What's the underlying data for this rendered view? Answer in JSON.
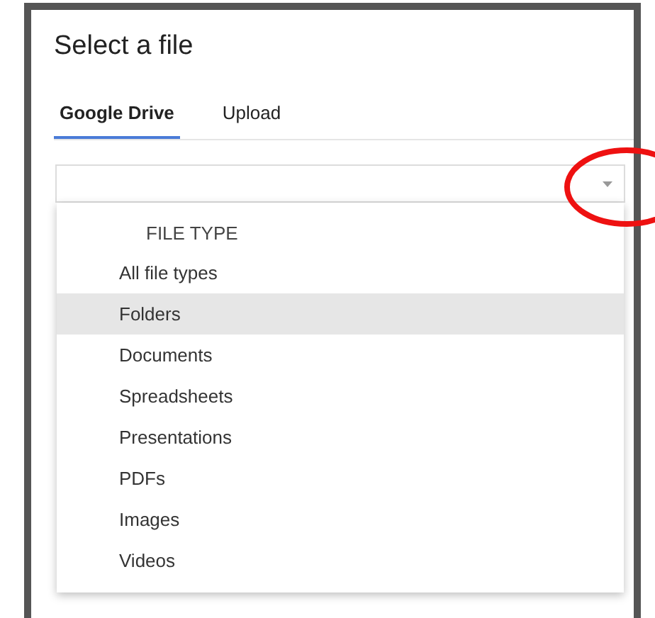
{
  "dialog": {
    "title": "Select a file"
  },
  "tabs": [
    {
      "label": "Google Drive",
      "selected": true
    },
    {
      "label": "Upload",
      "selected": false
    }
  ],
  "file_type_dropdown": {
    "expanded": true
  },
  "menu": {
    "header": "FILE TYPE",
    "items": [
      {
        "label": "All file types",
        "selected": false
      },
      {
        "label": "Folders",
        "selected": true
      },
      {
        "label": "Documents",
        "selected": false
      },
      {
        "label": "Spreadsheets",
        "selected": false
      },
      {
        "label": "Presentations",
        "selected": false
      },
      {
        "label": "PDFs",
        "selected": false
      },
      {
        "label": "Images",
        "selected": false
      },
      {
        "label": "Videos",
        "selected": false
      }
    ]
  }
}
